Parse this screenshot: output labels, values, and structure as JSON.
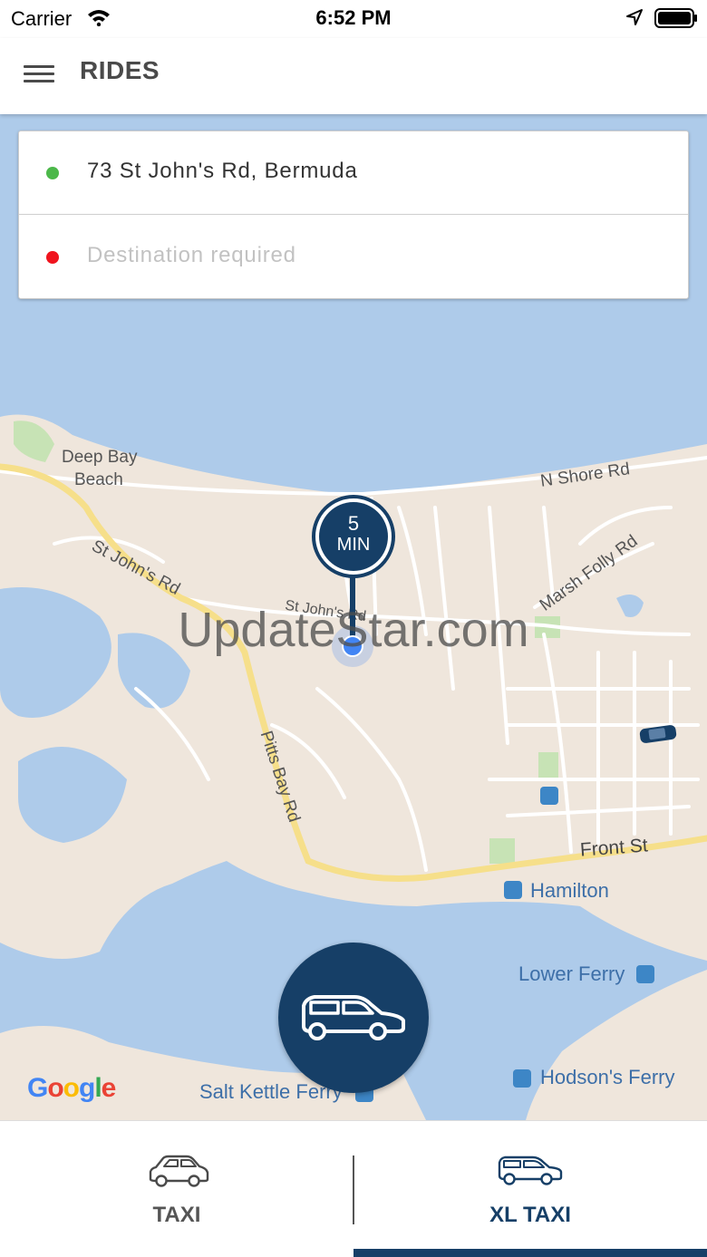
{
  "status_bar": {
    "carrier": "Carrier",
    "time": "6:52 PM",
    "icons": [
      "wifi-icon",
      "location-arrow-icon",
      "battery-icon"
    ]
  },
  "header": {
    "menu_icon": "hamburger-menu-icon",
    "title": "RIDES"
  },
  "address_card": {
    "origin": {
      "text": "73 St John's Rd, Bermuda",
      "dot_color": "#4cb84a"
    },
    "destination": {
      "placeholder": "Destination required",
      "dot_color": "#f0141e"
    }
  },
  "map": {
    "eta": {
      "value": "5",
      "unit": "MIN"
    },
    "labels": {
      "deep_bay": "Deep Bay",
      "beach": "Beach",
      "n_shore_rd": "N Shore Rd",
      "st_johns_rd_major": "St John's Rd",
      "st_johns_rd_minor": "St John's Rd",
      "marsh_folly_rd": "Marsh Folly Rd",
      "pitts_bay_rd": "Pitts Bay Rd",
      "front_st": "Front St",
      "hamilton": "Hamilton",
      "lower_ferry": "Lower Ferry",
      "hodsons_ferry": "Hodson's Ferry",
      "salt_kettle_ferry": "Salt Kettle Ferry"
    },
    "watermark": "UpdateStar.com",
    "attribution": {
      "g1": "G",
      "o1": "o",
      "o2": "o",
      "g2": "g",
      "l": "l",
      "e": "e"
    },
    "colors": {
      "water": "#aecbea",
      "land": "#efe6dc",
      "major_road": "#f6df8a",
      "brand": "#163f67"
    }
  },
  "request_button": {
    "icon": "car-icon"
  },
  "tabs": [
    {
      "label": "TAXI",
      "icon": "car-icon",
      "selected": false
    },
    {
      "label": "XL TAXI",
      "icon": "suv-icon",
      "selected": true
    }
  ]
}
